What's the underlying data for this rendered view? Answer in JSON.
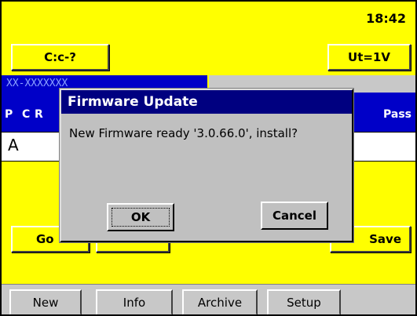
{
  "status": {
    "time": "18:42"
  },
  "toolbar": {
    "left_button": "C:c-?",
    "right_button": "Ut=1V"
  },
  "table": {
    "banner_text": "XX-XXXXXXX",
    "headers": [
      "P",
      "C",
      "R",
      "Pass"
    ],
    "row_first_cell": "A"
  },
  "background_buttons": {
    "go": "Go",
    "save": "Save"
  },
  "dialog": {
    "title": "Firmware Update",
    "message": "New Firmware ready '3.0.66.0', install?",
    "ok_label": "OK",
    "cancel_label": "Cancel"
  },
  "taskbar": {
    "tabs": [
      "New",
      "Info",
      "Archive",
      "Setup"
    ]
  },
  "colors": {
    "background": "#ffff00",
    "title_bar": "#000080",
    "table_header": "#0000c8",
    "dialog_face": "#c0c0c0"
  }
}
